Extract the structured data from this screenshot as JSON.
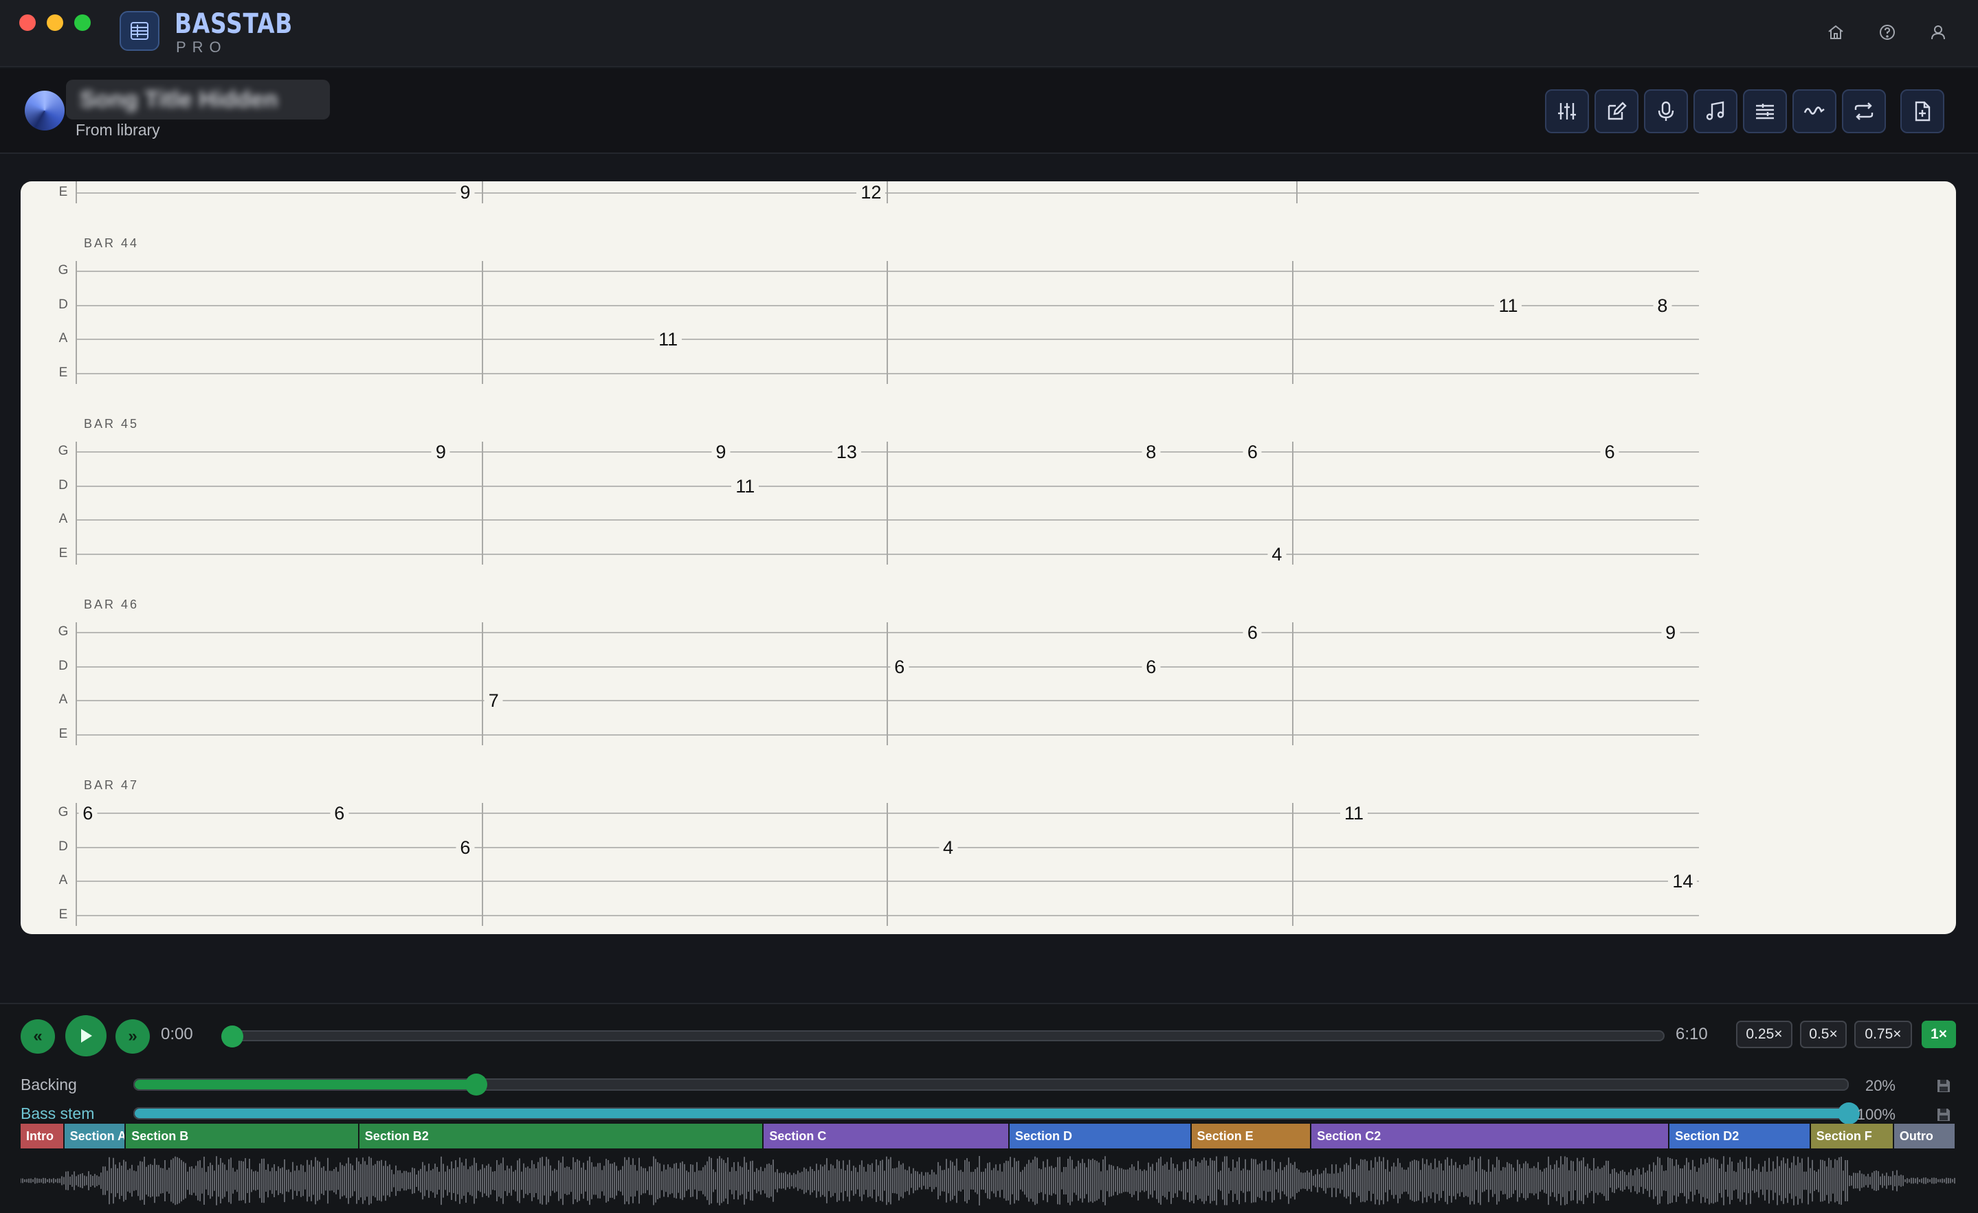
{
  "app": {
    "brand": "BASSTAB",
    "sub": "PRO",
    "colors": {
      "accent": "#1f9a4a",
      "brand": "#aac4ff",
      "paper": "#f5f4ee"
    },
    "window_icons": [
      "home-icon",
      "help-icon",
      "user-icon"
    ]
  },
  "song": {
    "title": "Song Title Hidden",
    "source": "From library"
  },
  "toolbar": {
    "buttons": [
      {
        "name": "mixer-icon"
      },
      {
        "name": "edit-icon"
      },
      {
        "name": "microphone-icon"
      },
      {
        "name": "music-note-icon"
      },
      {
        "name": "tab-lines-icon"
      },
      {
        "name": "waveform-icon"
      },
      {
        "name": "loop-icon"
      },
      {
        "name": "export-icon"
      }
    ]
  },
  "tab": {
    "partial_top": {
      "string": "E",
      "notes": [
        {
          "beat": 0.96,
          "fret": "9"
        },
        {
          "beat": 1.96,
          "fret": "12"
        }
      ]
    },
    "bars": [
      {
        "label": "BAR 44",
        "strings": [
          "G",
          "D",
          "A",
          "E"
        ],
        "notes": [
          {
            "string": "D",
            "beat": 3.53,
            "fret": "11"
          },
          {
            "string": "D",
            "beat": 3.91,
            "fret": "8"
          },
          {
            "string": "A",
            "beat": 1.46,
            "fret": "11"
          }
        ]
      },
      {
        "label": "BAR 45",
        "strings": [
          "G",
          "D",
          "A",
          "E"
        ],
        "notes": [
          {
            "string": "G",
            "beat": 0.9,
            "fret": "9"
          },
          {
            "string": "G",
            "beat": 1.59,
            "fret": "9"
          },
          {
            "string": "G",
            "beat": 1.9,
            "fret": "13"
          },
          {
            "string": "G",
            "beat": 2.65,
            "fret": "8"
          },
          {
            "string": "G",
            "beat": 2.9,
            "fret": "6"
          },
          {
            "string": "G",
            "beat": 3.78,
            "fret": "6"
          },
          {
            "string": "D",
            "beat": 1.65,
            "fret": "11"
          },
          {
            "string": "E",
            "beat": 2.96,
            "fret": "4"
          }
        ]
      },
      {
        "label": "BAR 46",
        "strings": [
          "G",
          "D",
          "A",
          "E"
        ],
        "notes": [
          {
            "string": "G",
            "beat": 2.9,
            "fret": "6"
          },
          {
            "string": "G",
            "beat": 3.93,
            "fret": "9"
          },
          {
            "string": "D",
            "beat": 2.03,
            "fret": "6"
          },
          {
            "string": "D",
            "beat": 2.65,
            "fret": "6"
          },
          {
            "string": "A",
            "beat": 1.03,
            "fret": "7"
          }
        ]
      },
      {
        "label": "BAR 47",
        "strings": [
          "G",
          "D",
          "A",
          "E"
        ],
        "notes": [
          {
            "string": "G",
            "beat": 0.03,
            "fret": "6"
          },
          {
            "string": "G",
            "beat": 0.65,
            "fret": "6"
          },
          {
            "string": "G",
            "beat": 3.15,
            "fret": "11"
          },
          {
            "string": "D",
            "beat": 0.96,
            "fret": "6"
          },
          {
            "string": "D",
            "beat": 2.15,
            "fret": "4"
          },
          {
            "string": "A",
            "beat": 3.96,
            "fret": "14"
          }
        ]
      }
    ]
  },
  "transport": {
    "rewind_label": "«",
    "forward_label": "»",
    "current_time": "0:00",
    "total_time": "6:10",
    "progress": 0,
    "speeds": [
      "0.25×",
      "0.5×",
      "0.75×",
      "1×"
    ],
    "active_speed": "1×",
    "volumes": [
      {
        "label": "Backing",
        "percent": "20%",
        "value": 0.2,
        "color": "#1f9a4a",
        "label_color": "#b7bac1"
      },
      {
        "label": "Bass stem",
        "percent": "100%",
        "value": 1.0,
        "color": "#35a7b8",
        "label_color": "#6fc6d4"
      }
    ]
  },
  "sections": [
    {
      "label": "Intro",
      "start": 0,
      "end": 0.0226,
      "color": "#b84e52"
    },
    {
      "label": "Section A",
      "start": 0.0226,
      "end": 0.0544,
      "color": "#3f8fa2"
    },
    {
      "label": "Section B",
      "start": 0.0544,
      "end": 0.175,
      "color": "#2c8a47"
    },
    {
      "label": "Section B2",
      "start": 0.175,
      "end": 0.384,
      "color": "#2c8a47"
    },
    {
      "label": "Section C",
      "start": 0.384,
      "end": 0.511,
      "color": "#7656b4"
    },
    {
      "label": "Section D",
      "start": 0.511,
      "end": 0.605,
      "color": "#3d6dc6"
    },
    {
      "label": "Section E",
      "start": 0.605,
      "end": 0.667,
      "color": "#b27b36"
    },
    {
      "label": "Section C2",
      "start": 0.667,
      "end": 0.852,
      "color": "#7656b4"
    },
    {
      "label": "Section D2",
      "start": 0.852,
      "end": 0.925,
      "color": "#3d6dc6"
    },
    {
      "label": "Section F",
      "start": 0.925,
      "end": 0.968,
      "color": "#8c8a43"
    },
    {
      "label": "Outro",
      "start": 0.968,
      "end": 1.0,
      "color": "#6a7388"
    }
  ]
}
